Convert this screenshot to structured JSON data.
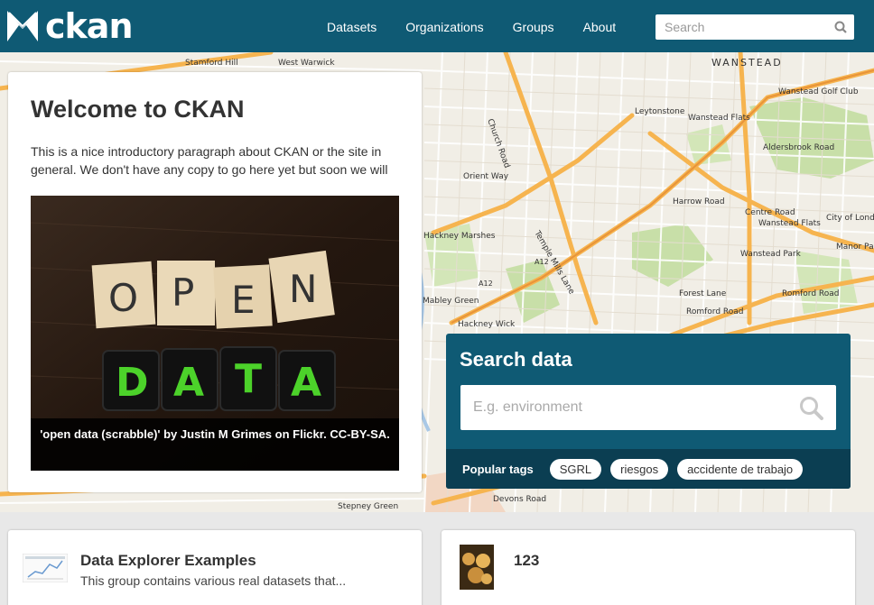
{
  "header": {
    "logo_text": "ckan",
    "nav": [
      "Datasets",
      "Organizations",
      "Groups",
      "About"
    ],
    "search_placeholder": "Search"
  },
  "welcome": {
    "title": "Welcome to CKAN",
    "paragraph": "This is a nice introductory paragraph about CKAN or the site in general. We don't have any copy to go here yet but soon we will",
    "photo_caption": "'open data (scrabble)' by Justin M Grimes on Flickr. CC-BY-SA.",
    "photo_letters_top": [
      "O",
      "P",
      "E",
      "N"
    ],
    "photo_letters_bottom": [
      "D",
      "A",
      "T",
      "A"
    ]
  },
  "map_labels": [
    "Stamford Hill",
    "West Warwick",
    "WANSTEAD",
    "Wanstead Golf Club",
    "Leytonstone",
    "Wanstead Flats",
    "Aldersbrook Road",
    "Harrow Road",
    "Centre Road",
    "Wanstead Flats",
    "City of London",
    "Manor Pa",
    "Hackney Marshes",
    "Wanstead Park",
    "Forest Lane",
    "Romford Road",
    "Romford Road",
    "Mabley Green",
    "Hackney Wick",
    "Devons Road",
    "Stepney Green",
    "Orient Way",
    "Church Road",
    "Temple Mills Lane",
    "A12",
    "A12"
  ],
  "search_data": {
    "title": "Search data",
    "placeholder": "E.g. environment",
    "popular_tags_label": "Popular tags",
    "tags": [
      "SGRL",
      "riesgos",
      "accidente de trabajo"
    ]
  },
  "cards": [
    {
      "title": "Data Explorer Examples",
      "description": "This group contains various real datasets that..."
    },
    {
      "title": "123",
      "description": ""
    }
  ],
  "colors": {
    "header": "#0f5a74",
    "tags_bar": "#0b3e52",
    "road_major": "#f6b44f",
    "road_minor": "#ffffff",
    "park": "#c8dfa8"
  }
}
